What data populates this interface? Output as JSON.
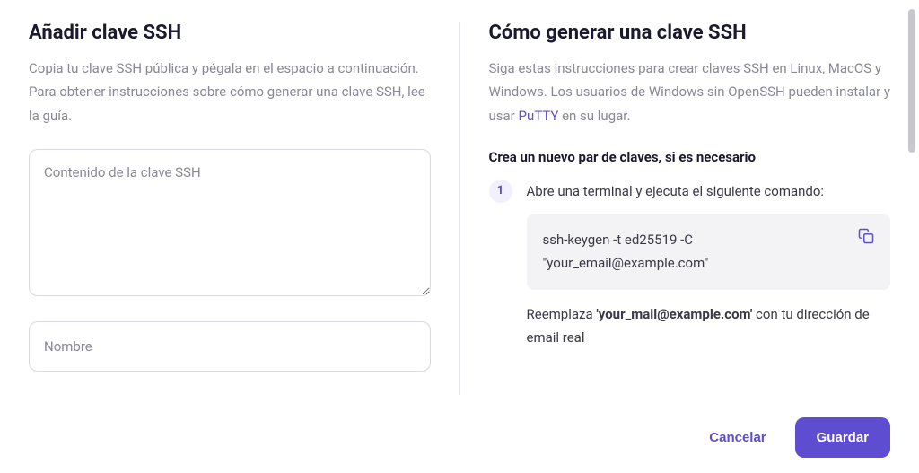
{
  "left": {
    "title": "Añadir clave SSH",
    "description": "Copia tu clave SSH pública y pégala en el espacio a continuación. Para obtener instrucciones sobre cómo generar una clave SSH, lee la guía.",
    "ssh_content_placeholder": "Contenido de la clave SSH",
    "name_placeholder": "Nombre"
  },
  "right": {
    "title": "Cómo generar una clave SSH",
    "description_pre": "Siga estas instrucciones para crear claves SSH en Linux, MacOS y Windows. Los usuarios de Windows sin OpenSSH pueden instalar y usar ",
    "link_label": "PuTTY",
    "description_post": " en su lugar.",
    "subheading": "Crea un nuevo par de claves, si es necesario",
    "step1": {
      "number": "1",
      "text": "Abre una terminal y ejecuta el siguiente comando:",
      "code": "ssh-keygen -t ed25519 -C \"your_email@example.com\"",
      "replace_pre": "Reemplaza ",
      "replace_bold": "'your_mail@example.com'",
      "replace_post": " con tu dirección de email real"
    }
  },
  "footer": {
    "cancel": "Cancelar",
    "save": "Guardar"
  },
  "colors": {
    "primary": "#5f4dd1",
    "text_muted": "#888896",
    "text_dark": "#1a1a2e"
  }
}
